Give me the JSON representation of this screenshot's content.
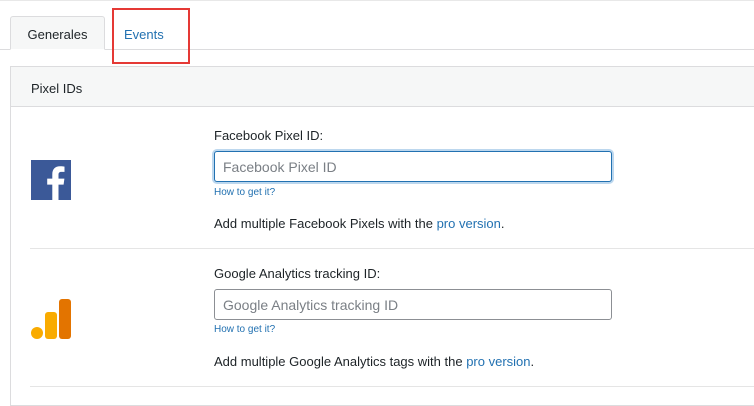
{
  "tabs": [
    {
      "label": "Generales",
      "active": true
    },
    {
      "label": "Events",
      "active": false,
      "highlighted": true
    }
  ],
  "panel": {
    "title": "Pixel IDs",
    "facebook": {
      "icon": "facebook-icon",
      "label": "Facebook Pixel ID:",
      "value": "",
      "placeholder": "Facebook Pixel ID",
      "help_link": "How to get it?",
      "note_prefix": "Add multiple Facebook Pixels with the ",
      "note_link": "pro version",
      "note_suffix": "."
    },
    "google": {
      "icon": "google-analytics-icon",
      "label": "Google Analytics tracking ID:",
      "value": "",
      "placeholder": "Google Analytics tracking ID",
      "help_link": "How to get it?",
      "note_prefix": "Add multiple Google Analytics tags with the ",
      "note_link": "pro version",
      "note_suffix": "."
    }
  },
  "colors": {
    "link": "#2271b1",
    "facebook_brand": "#3b5998",
    "ga_light": "#f9ab00",
    "ga_dark": "#e37400",
    "highlight_box": "#e53935"
  }
}
